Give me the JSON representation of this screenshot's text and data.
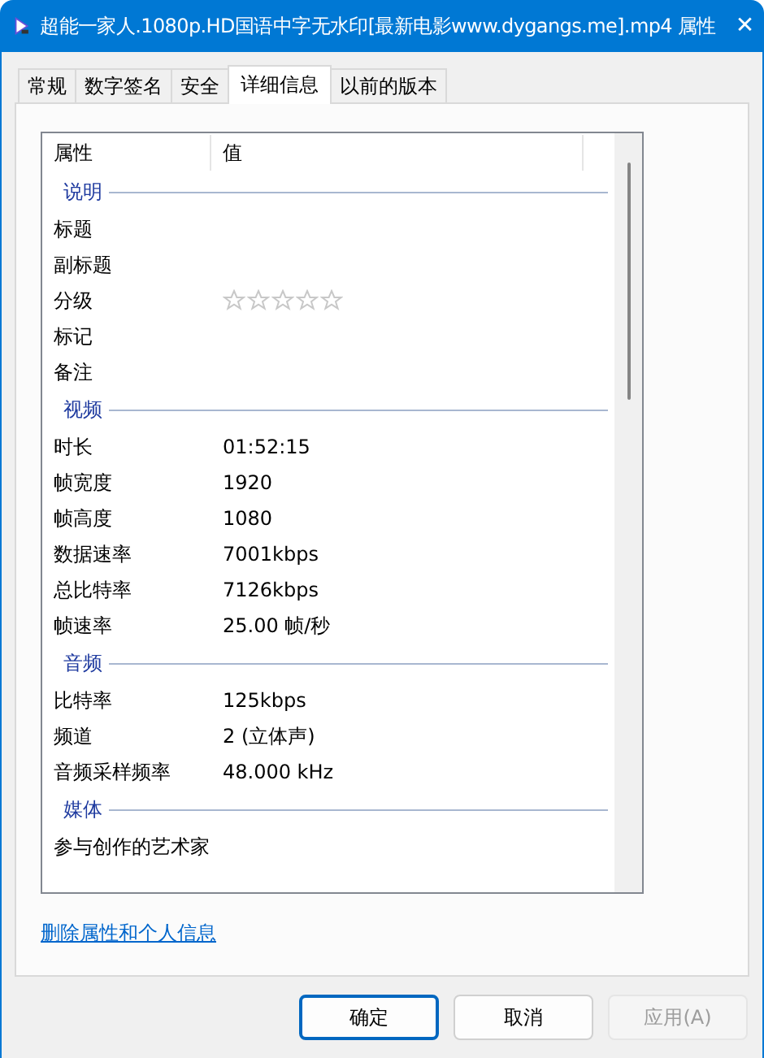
{
  "window": {
    "title": "超能一家人.1080p.HD国语中字无水印[最新电影www.dygangs.me].mp4 属性",
    "close": "✕"
  },
  "tabs": [
    {
      "label": "常规",
      "selected": false
    },
    {
      "label": "数字签名",
      "selected": false
    },
    {
      "label": "安全",
      "selected": false
    },
    {
      "label": "详细信息",
      "selected": true
    },
    {
      "label": "以前的版本",
      "selected": false
    }
  ],
  "details": {
    "columns": [
      "属性",
      "值"
    ],
    "groups": [
      {
        "title": "说明",
        "rows": [
          {
            "kind": "text",
            "name": "标题"
          },
          {
            "kind": "text",
            "name": "副标题"
          },
          {
            "kind": "rating",
            "name": "分级",
            "stars": 0
          },
          {
            "kind": "text",
            "name": "标记"
          },
          {
            "kind": "text",
            "name": "备注"
          }
        ]
      },
      {
        "title": "视频",
        "rows": [
          {
            "kind": "text",
            "name": "时长",
            "value": "01:52:15"
          },
          {
            "kind": "text",
            "name": "帧宽度",
            "value": "1920"
          },
          {
            "kind": "text",
            "name": "帧高度",
            "value": "1080"
          },
          {
            "kind": "text",
            "name": "数据速率",
            "value": "7001kbps"
          },
          {
            "kind": "text",
            "name": "总比特率",
            "value": "7126kbps"
          },
          {
            "kind": "text",
            "name": "帧速率",
            "value": "25.00 帧/秒"
          }
        ]
      },
      {
        "title": "音频",
        "rows": [
          {
            "kind": "text",
            "name": "比特率",
            "value": "125kbps"
          },
          {
            "kind": "text",
            "name": "频道",
            "value": "2 (立体声)"
          },
          {
            "kind": "text",
            "name": "音频采样频率",
            "value": "48.000 kHz"
          }
        ]
      },
      {
        "title": "媒体",
        "rows": [
          {
            "kind": "text",
            "name": "参与创作的艺术家"
          }
        ]
      }
    ]
  },
  "link": "删除属性和个人信息",
  "buttons": [
    {
      "label": "确定",
      "disabled": false,
      "default": true
    },
    {
      "label": "取消",
      "disabled": false,
      "default": false
    },
    {
      "label": "应用(A)",
      "disabled": true,
      "default": false
    }
  ]
}
